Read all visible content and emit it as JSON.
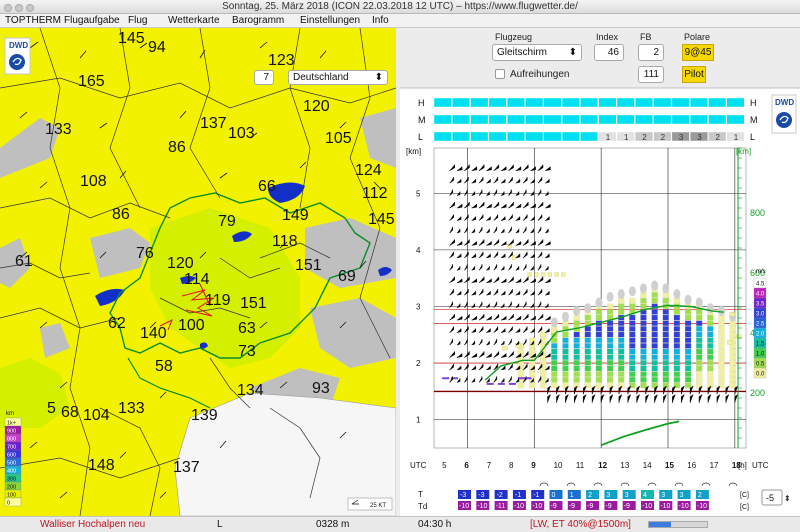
{
  "window": {
    "title": "Sonntag, 25. März 2018 (ICON 22.03.2018 12 UTC) – https://www.flugwetter.de/"
  },
  "menu": {
    "items": [
      "TOPTHERM",
      "Flugaufgabe",
      "Flug",
      "Wetterkarte",
      "Barogramm",
      "Einstellungen",
      "Info"
    ]
  },
  "map": {
    "logo": "DWD",
    "zoom_value": "7",
    "region_value": "Deutschland",
    "scale_label": "25 KT",
    "legend": {
      "unit": "km",
      "entries": [
        {
          "label": "1k+",
          "color": "#ffffa0"
        },
        {
          "label": "900",
          "color": "#9b1ba0"
        },
        {
          "label": "800",
          "color": "#c23bc8"
        },
        {
          "label": "700",
          "color": "#6b1fd0"
        },
        {
          "label": "600",
          "color": "#3a35d8"
        },
        {
          "label": "500",
          "color": "#2a6bd8"
        },
        {
          "label": "400",
          "color": "#1ab0d8"
        },
        {
          "label": "300",
          "color": "#26c98a"
        },
        {
          "label": "200",
          "color": "#8ad63a"
        },
        {
          "label": "100",
          "color": "#e8f000"
        },
        {
          "label": "0",
          "color": "#ffffa0"
        }
      ]
    },
    "values": [
      "145",
      "94",
      "123",
      "165",
      "133",
      "86",
      "137",
      "103",
      "120",
      "105",
      "108",
      "66",
      "124",
      "112",
      "86",
      "149",
      "145",
      "79",
      "118",
      "76",
      "61",
      "120",
      "151",
      "69",
      "114",
      "62",
      "119",
      "151",
      "140",
      "100",
      "63",
      "73",
      "58",
      "134",
      "93",
      "5",
      "68",
      "104",
      "133",
      "139",
      "148",
      "137"
    ],
    "colors": {
      "yellow": "#f2f200",
      "lime": "#d4f000",
      "grey": "#bfbfbf",
      "white": "#f6f6f6",
      "lake": "#1230c8",
      "border": "#0a8a2a"
    }
  },
  "controls": {
    "flugzeug_label": "Flugzeug",
    "flugzeug_value": "Gleitschirm",
    "index_label": "Index",
    "index_value": "46",
    "fb_label": "FB",
    "fb_value": "2",
    "polare_label": "Polare",
    "polare_value": "9@45",
    "aufreihungen_label": "Aufreihungen",
    "pilot_value": "111",
    "pilot_label": "Pilot"
  },
  "sounding": {
    "cloud_rows": [
      {
        "label": "H",
        "values": []
      },
      {
        "label": "M",
        "values": []
      },
      {
        "label": "L",
        "values": [
          "",
          "",
          "",
          "",
          "",
          "",
          "",
          "",
          "",
          "1",
          "1",
          "2",
          "2",
          "3",
          "3",
          "2",
          "1"
        ]
      }
    ],
    "km_axis_label": "[km]",
    "km_ticks": [
      "5",
      "4",
      "3",
      "2",
      "1"
    ],
    "right_axis_label": "[km]",
    "right_ticks": [
      "800",
      "600",
      "400",
      "200"
    ],
    "hour_axis_label_left": "UTC",
    "hours": [
      "5",
      "6",
      "7",
      "8",
      "9",
      "10",
      "11",
      "12",
      "13",
      "14",
      "15",
      "16",
      "17",
      "18"
    ],
    "hour_unit": "[h]",
    "hour_axis_label_right": "UTC",
    "climb_legend_unit": "m/s",
    "climb_legend": [
      {
        "label": "4.5",
        "color": "#ffffff"
      },
      {
        "label": "4.0",
        "color": "#c020c0"
      },
      {
        "label": "3.5",
        "color": "#7020d0"
      },
      {
        "label": "3.0",
        "color": "#3040d8"
      },
      {
        "label": "2.5",
        "color": "#2060e0"
      },
      {
        "label": "2.0",
        "color": "#10b0e0"
      },
      {
        "label": "1.5",
        "color": "#10c0a0"
      },
      {
        "label": "1.0",
        "color": "#40d050"
      },
      {
        "label": "0.5",
        "color": "#a0e050"
      },
      {
        "label": "0.0",
        "color": "#f0f0a0"
      }
    ],
    "logo": "DWD",
    "T_label": "T",
    "Td_label": "Td",
    "T_values": [
      "-3",
      "-3",
      "-2",
      "-1",
      "-1",
      "0",
      "1",
      "2",
      "3",
      "3",
      "4",
      "3",
      "3",
      "2"
    ],
    "Td_values": [
      "-10",
      "-10",
      "-11",
      "-10",
      "-10",
      "-9",
      "-9",
      "-9",
      "-9",
      "-9",
      "-10",
      "-10",
      "-10",
      "-10"
    ],
    "T_unit": "[C]",
    "Td_unit": "[C]",
    "offset_value": "-5"
  },
  "status": {
    "location": "Walliser Hochalpen neu",
    "mode": "L",
    "height": "0328 m",
    "time": "04:30 h",
    "info": "[LW, ET  40%@1500m]"
  }
}
